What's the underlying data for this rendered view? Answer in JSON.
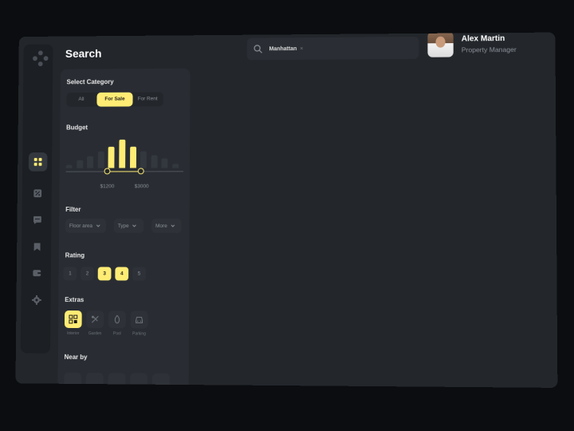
{
  "header": {
    "title": "Search"
  },
  "search": {
    "chip": "Manhattan",
    "chip_remove": "×"
  },
  "user": {
    "name": "Alex Martin",
    "role": "Property Manager"
  },
  "sidebar": {
    "items": [
      {
        "icon": "grid-icon",
        "active": true
      },
      {
        "icon": "discount-icon",
        "active": false
      },
      {
        "icon": "chat-icon",
        "active": false
      },
      {
        "icon": "bookmark-icon",
        "active": false
      },
      {
        "icon": "wallet-icon",
        "active": false
      },
      {
        "icon": "gear-icon",
        "active": false
      }
    ]
  },
  "filters": {
    "category": {
      "title": "Select Category",
      "options": [
        "All",
        "For Sale",
        "For Rent"
      ],
      "selected": "For Sale"
    },
    "budget": {
      "title": "Budget",
      "min_label": "$1200",
      "max_label": "$3000",
      "histogram": [
        0.1,
        0.25,
        0.35,
        0.5,
        0.65,
        0.85,
        0.65,
        0.5,
        0.38,
        0.28,
        0.12
      ],
      "selected_range": [
        4,
        6
      ],
      "range_fraction": [
        0.35,
        0.64
      ]
    },
    "filter": {
      "title": "Filter",
      "dropdowns": [
        "Floor area",
        "Type",
        "More"
      ]
    },
    "rating": {
      "title": "Rating",
      "values": [
        "1",
        "2",
        "3",
        "4",
        "5"
      ],
      "selected": [
        "3",
        "4"
      ]
    },
    "extras": {
      "title": "Extras",
      "items": [
        {
          "label": "Interior",
          "icon": "interior-icon",
          "active": true
        },
        {
          "label": "Garden",
          "icon": "garden-icon",
          "active": false
        },
        {
          "label": "Pool",
          "icon": "pool-icon",
          "active": false
        },
        {
          "label": "Parking",
          "icon": "parking-icon",
          "active": false
        }
      ]
    },
    "near_by": {
      "title": "Near by"
    }
  },
  "colors": {
    "accent": "#ffec74",
    "background": "#23272c",
    "panel": "#292d33",
    "sidebar": "#1c1f23"
  }
}
